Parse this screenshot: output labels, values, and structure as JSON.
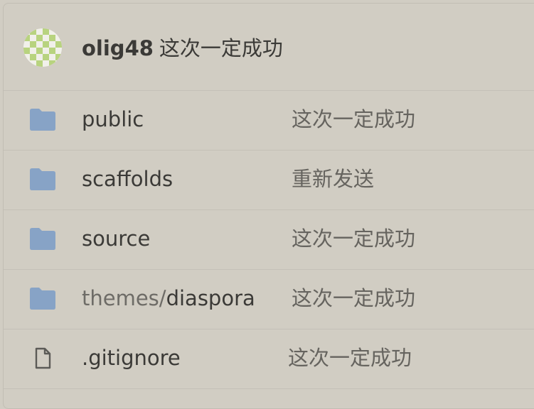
{
  "header": {
    "user": "olig48",
    "commit_message": "这次一定成功"
  },
  "files": [
    {
      "type": "folder",
      "icon": "folder-icon",
      "name_prefix": "",
      "name": "public",
      "message": "这次一定成功"
    },
    {
      "type": "folder",
      "icon": "folder-icon",
      "name_prefix": "",
      "name": "scaffolds",
      "message": "重新发送"
    },
    {
      "type": "folder",
      "icon": "folder-icon",
      "name_prefix": "",
      "name": "source",
      "message": "这次一定成功"
    },
    {
      "type": "folder",
      "icon": "folder-icon",
      "name_prefix": "themes/",
      "name": "diaspora",
      "message": "这次一定成功"
    },
    {
      "type": "file",
      "icon": "file-icon",
      "name_prefix": "",
      "name": ".gitignore",
      "message": "这次一定成功"
    }
  ],
  "colors": {
    "background": "#d1cdc3",
    "folder": "#87a3c6",
    "file_outline": "#5c5b57",
    "avatar_green": "#b8d37f"
  }
}
